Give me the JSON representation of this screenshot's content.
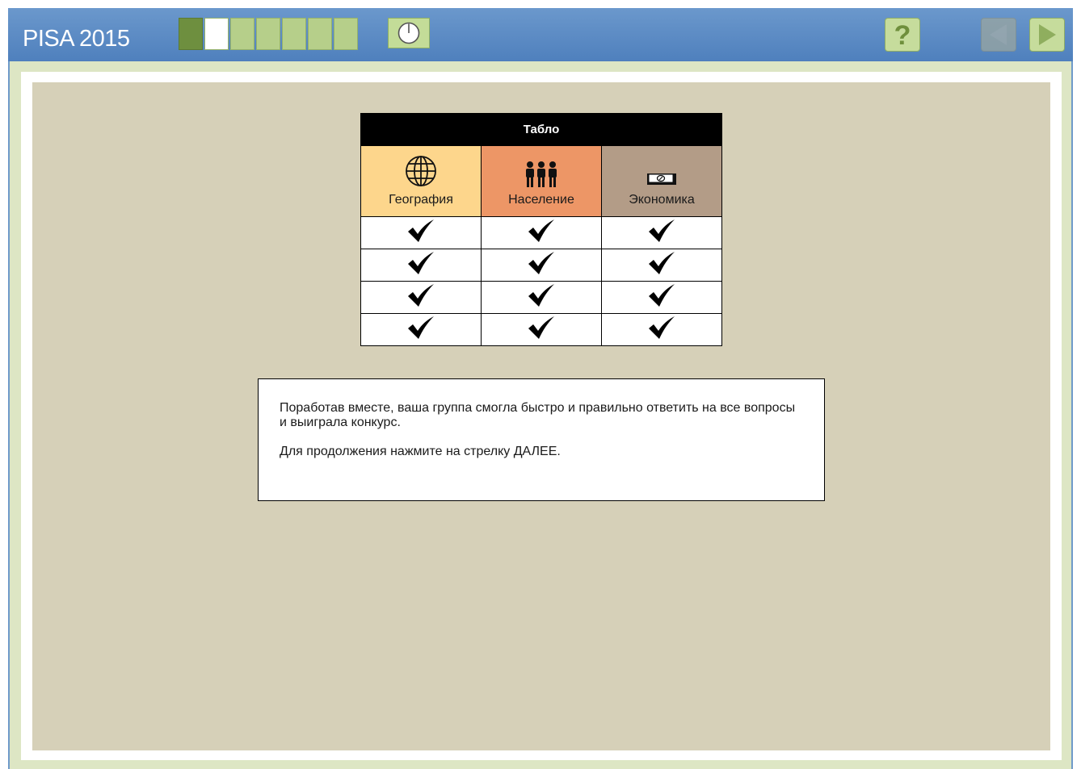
{
  "header": {
    "title": "PISA 2015",
    "progress": {
      "total": 7,
      "done": 1,
      "current_index": 2
    }
  },
  "scoreboard": {
    "title": "Табло",
    "categories": [
      {
        "label": "География",
        "icon": "globe-icon",
        "color": "#fdd68c"
      },
      {
        "label": "Население",
        "icon": "people-icon",
        "color": "#ed9666"
      },
      {
        "label": "Экономика",
        "icon": "money-icon",
        "color": "#b39c87"
      }
    ],
    "rows": 4,
    "mark": "check"
  },
  "message": {
    "paragraph1": "Поработав вместе, ваша группа смогла быстро и правильно ответить на все вопросы и выиграла конкурс.",
    "paragraph2": "Для продолжения нажмите на стрелку ДАЛЕЕ."
  },
  "colors": {
    "header_blue": "#5a89c4",
    "progress_green": "#b6cf8a",
    "content_bg": "#d6d0b8"
  }
}
